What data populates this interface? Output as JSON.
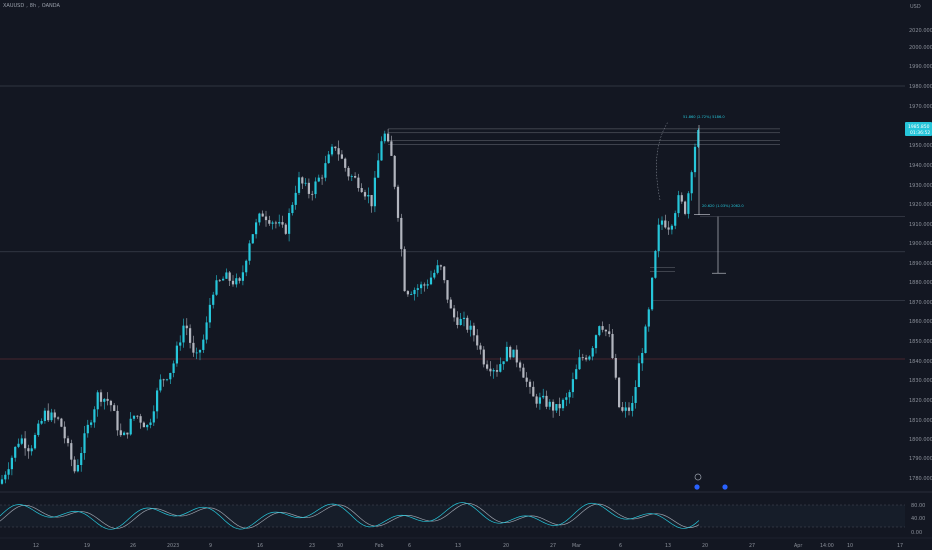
{
  "header": {
    "symbol": "XAUUSD",
    "timeframe": "8h",
    "exchange": "OANDA"
  },
  "currency": "USD",
  "last_price": {
    "value": "1985.850",
    "countdown": "01:36:52"
  },
  "price_ticks": [
    "2020.000",
    "2000.000",
    "1990.000",
    "1980.000",
    "1970.000",
    "1960.000",
    "1950.000",
    "1940.000",
    "1930.000",
    "1920.000",
    "1910.000",
    "1900.000",
    "1890.000",
    "1880.000",
    "1870.000",
    "1860.000",
    "1850.000",
    "1840.000",
    "1830.000",
    "1820.000",
    "1810.000",
    "1800.000",
    "1790.000",
    "1780.000"
  ],
  "stoch_ticks": [
    "80.00",
    "40.00",
    "0.00"
  ],
  "time_ticks": [
    "12",
    "19",
    "26",
    "2023",
    "9",
    "16",
    "23",
    "30",
    "Feb",
    "6",
    "13",
    "20",
    "27",
    "Mar",
    "6",
    "13",
    "20",
    "27",
    "Apr",
    "14:00",
    "10",
    "17"
  ],
  "measure_labels": {
    "upper": "51.860 (2.72%) 5186.0",
    "lower": "20.620 (1.03%) 2062.0"
  },
  "colors": {
    "background": "#131722",
    "bull": "#26c6da",
    "bear": "#b2b5be",
    "stoch_k": "#26c6da",
    "stoch_d": "#9aa0ab",
    "grid_line": "#3a3f4b",
    "red_line": "#5a2a35",
    "last_price_bg": "#26c6da"
  },
  "icons": [
    "clock-event-icon",
    "calendar-event-icon",
    "calendar-event-icon"
  ]
}
